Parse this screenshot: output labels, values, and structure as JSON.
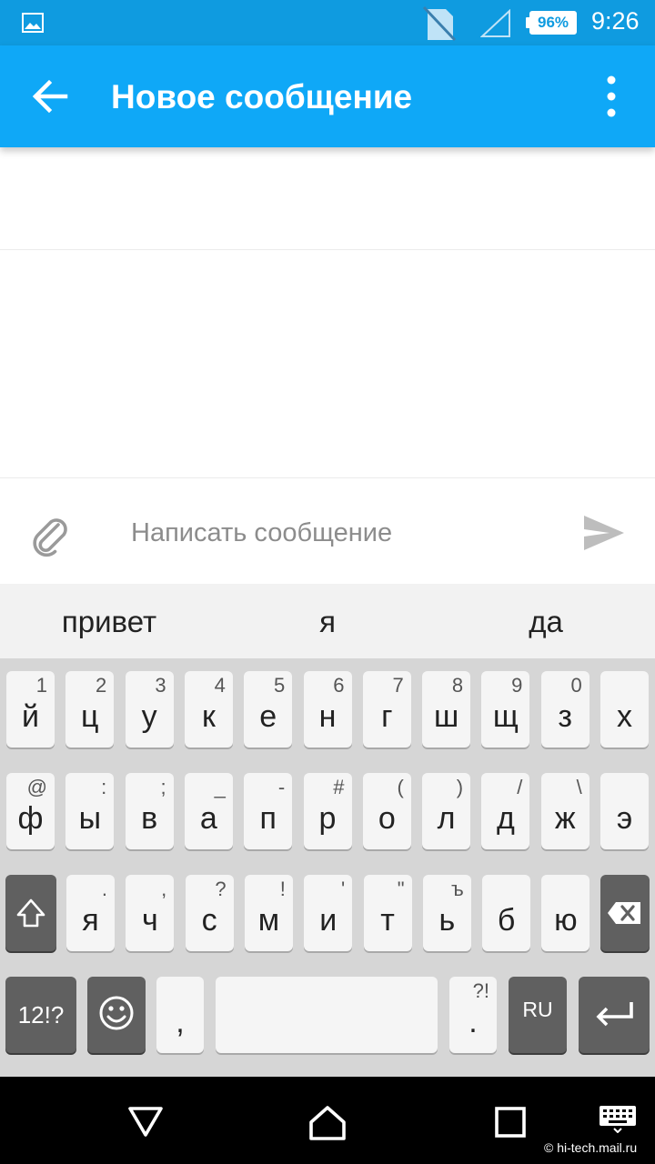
{
  "status_bar": {
    "battery_percent": "96%",
    "time": "9:26",
    "icons": [
      "image-notification-icon",
      "no-sim-icon",
      "signal-icon",
      "battery-icon"
    ]
  },
  "app_bar": {
    "title": "Новое сообщение",
    "back_icon": "arrow-back-icon",
    "menu_icon": "more-vert-icon"
  },
  "compose": {
    "placeholder": "Написать сообщение",
    "attach_icon": "paperclip-icon",
    "send_icon": "send-icon"
  },
  "suggestions": [
    "привет",
    "я",
    "да"
  ],
  "keyboard": {
    "row1": [
      {
        "main": "й",
        "hint": "1"
      },
      {
        "main": "ц",
        "hint": "2"
      },
      {
        "main": "у",
        "hint": "3"
      },
      {
        "main": "к",
        "hint": "4"
      },
      {
        "main": "е",
        "hint": "5"
      },
      {
        "main": "н",
        "hint": "6"
      },
      {
        "main": "г",
        "hint": "7"
      },
      {
        "main": "ш",
        "hint": "8"
      },
      {
        "main": "щ",
        "hint": "9"
      },
      {
        "main": "з",
        "hint": "0"
      },
      {
        "main": "х",
        "hint": ""
      }
    ],
    "row2": [
      {
        "main": "ф",
        "hint": "@"
      },
      {
        "main": "ы",
        "hint": ":"
      },
      {
        "main": "в",
        "hint": ";"
      },
      {
        "main": "а",
        "hint": "_"
      },
      {
        "main": "п",
        "hint": "-"
      },
      {
        "main": "р",
        "hint": "#"
      },
      {
        "main": "о",
        "hint": "("
      },
      {
        "main": "л",
        "hint": ")"
      },
      {
        "main": "д",
        "hint": "/"
      },
      {
        "main": "ж",
        "hint": "\\"
      },
      {
        "main": "э",
        "hint": ""
      }
    ],
    "row3": [
      {
        "main": "я",
        "hint": "."
      },
      {
        "main": "ч",
        "hint": ","
      },
      {
        "main": "с",
        "hint": "?"
      },
      {
        "main": "м",
        "hint": "!"
      },
      {
        "main": "и",
        "hint": "'"
      },
      {
        "main": "т",
        "hint": "\""
      },
      {
        "main": "ь",
        "hint": "ъ"
      },
      {
        "main": "б",
        "hint": ""
      },
      {
        "main": "ю",
        "hint": ""
      }
    ],
    "shift_icon": "shift-icon",
    "backspace_icon": "backspace-icon",
    "symbols_label": "12!?",
    "emoji_icon": "emoji-icon",
    "comma": ",",
    "period": ".",
    "period_hint": "?!",
    "lang_label": "RU",
    "enter_icon": "enter-icon"
  },
  "nav_bar": {
    "icons": [
      "back-triangle-icon",
      "home-icon",
      "recents-icon",
      "keyboard-switch-icon"
    ]
  },
  "watermark": "© hi-tech.mail.ru",
  "colors": {
    "status_bar": "#0f9be0",
    "app_bar": "#0fa8f7",
    "keyboard_bg": "#d6d6d6",
    "key_light": "#f5f5f5",
    "key_dark": "#606060"
  }
}
